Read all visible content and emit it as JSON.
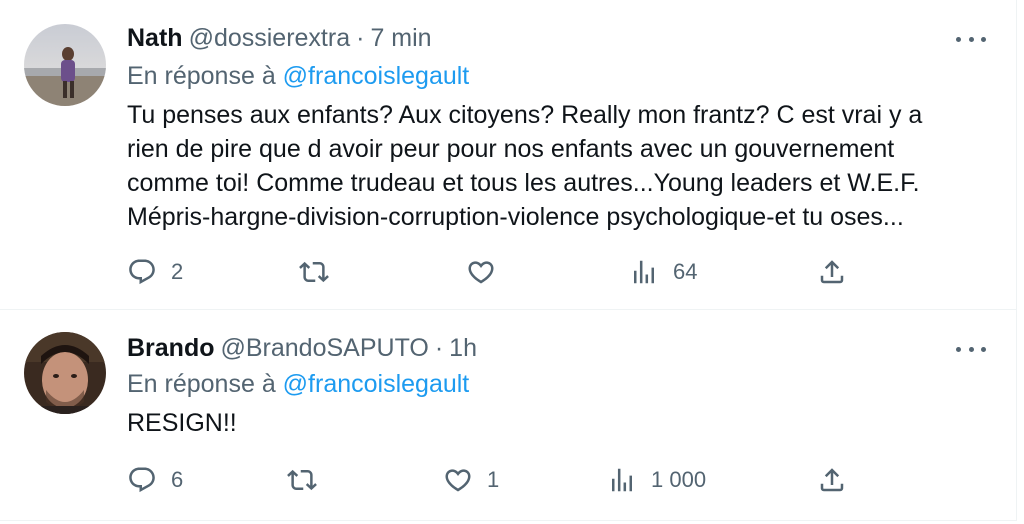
{
  "tweets": [
    {
      "name": "Nath",
      "handle": "@dossierextra",
      "separator": "·",
      "time": "7 min",
      "reply_prefix": "En réponse à",
      "reply_handle": "@francoislegault",
      "body_lines": [
        "Tu penses aux enfants? Aux citoyens? Really mon frantz? C est vrai y a",
        "rien de pire que d avoir peur pour nos enfants avec un gouvernement",
        "comme toi! Comme trudeau et tous les autres...Young leaders et W.E.F.",
        "Mépris-hargne-division-corruption-violence psychologique-et tu oses..."
      ],
      "replies": "2",
      "retweets": "",
      "likes": "",
      "views": "64"
    },
    {
      "name": "Brando",
      "handle": "@BrandoSAPUTO",
      "separator": "·",
      "time": "1h",
      "reply_prefix": "En réponse à",
      "reply_handle": "@francoislegault",
      "body_lines": [
        "RESIGN!!"
      ],
      "replies": "6",
      "retweets": "",
      "likes": "1",
      "views": "1 000"
    }
  ],
  "icons": {
    "reply": "reply-icon",
    "retweet": "retweet-icon",
    "like": "heart-icon",
    "views": "views-icon",
    "share": "share-icon",
    "more": "more-icon"
  },
  "colors": {
    "text": "#0f1419",
    "secondary": "#536471",
    "accent": "#1d9bf0",
    "border": "#eff3f4"
  }
}
